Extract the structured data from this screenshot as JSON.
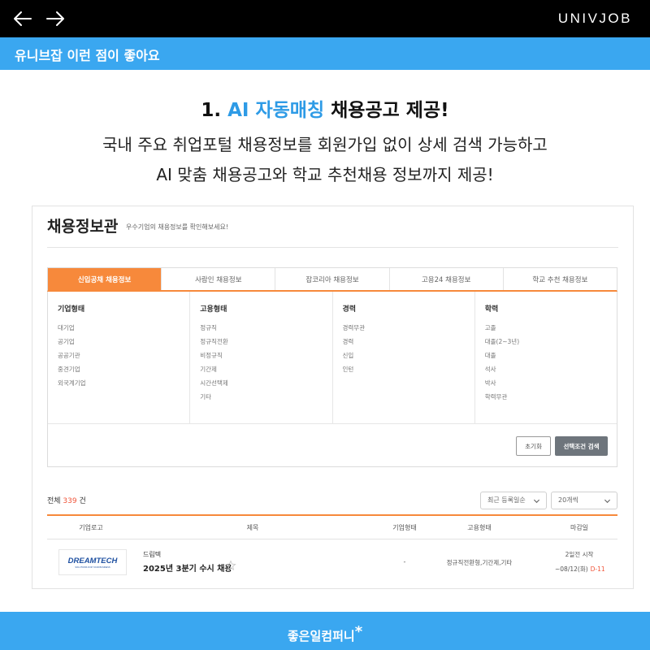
{
  "header": {
    "brand": "UNIVJOB",
    "section_title": "유니브잡 이런 점이 좋아요"
  },
  "hero": {
    "headline_prefix": "1. ",
    "headline_highlight": "AI 자동매칭",
    "headline_suffix": " 채용공고 제공!",
    "line1": "국내 주요 취업포털 채용정보를 회원가입 없이 상세 검색 가능하고",
    "line2": "AI 맞춤 채용공고와 학교 추천채용 정보까지 제공!"
  },
  "panel": {
    "title": "채용정보관",
    "description": "우수기업의 채용정보를 확인해보세요!",
    "tabs": [
      {
        "label": "신입공채 채용정보",
        "active": true
      },
      {
        "label": "사람인 채용정보",
        "active": false
      },
      {
        "label": "잡코리아 채용정보",
        "active": false
      },
      {
        "label": "고용24 채용정보",
        "active": false
      },
      {
        "label": "학교 추천 채용정보",
        "active": false
      }
    ],
    "filters": [
      {
        "heading": "기업형태",
        "options": [
          "대기업",
          "공기업",
          "공공기관",
          "중견기업",
          "외국계기업"
        ]
      },
      {
        "heading": "고용형태",
        "options": [
          "정규직",
          "정규직전환",
          "비정규직",
          "기간제",
          "시간선택제",
          "기타"
        ]
      },
      {
        "heading": "경력",
        "options": [
          "경력무관",
          "경력",
          "신입",
          "인턴"
        ]
      },
      {
        "heading": "학력",
        "options": [
          "고졸",
          "대졸(2~3년)",
          "대졸",
          "석사",
          "박사",
          "학력무관"
        ]
      }
    ],
    "reset_label": "초기화",
    "search_label": "선택조건 검색",
    "total_prefix": "전체 ",
    "total_count": "339",
    "total_suffix": " 건",
    "sort_selected": "최근 등록일순",
    "count_selected": "20개씩",
    "columns": {
      "logo": "기업로고",
      "title": "제목",
      "company_type": "기업형태",
      "employment_type": "고용형태",
      "deadline": "마감일"
    },
    "rows": [
      {
        "logo_text": "DREAMTECH",
        "logo_subtext": "SOLUTIONS FOR YOUR BUSINESS",
        "company": "드림텍",
        "title": "2025년 3분기 수시 채용",
        "company_type": "-",
        "employment_type": "정규직전환형,기간제,기타",
        "start": "2일전 시작",
        "end": "~08/12(화)",
        "dday": "D-11"
      }
    ]
  },
  "footer": {
    "text": "좋은일컴퍼니",
    "mark": "*"
  },
  "colors": {
    "accent_blue": "#3aa7f0",
    "tab_orange": "#f7893b",
    "count_red": "#f0563b",
    "logo_blue": "#1d4fa0"
  }
}
